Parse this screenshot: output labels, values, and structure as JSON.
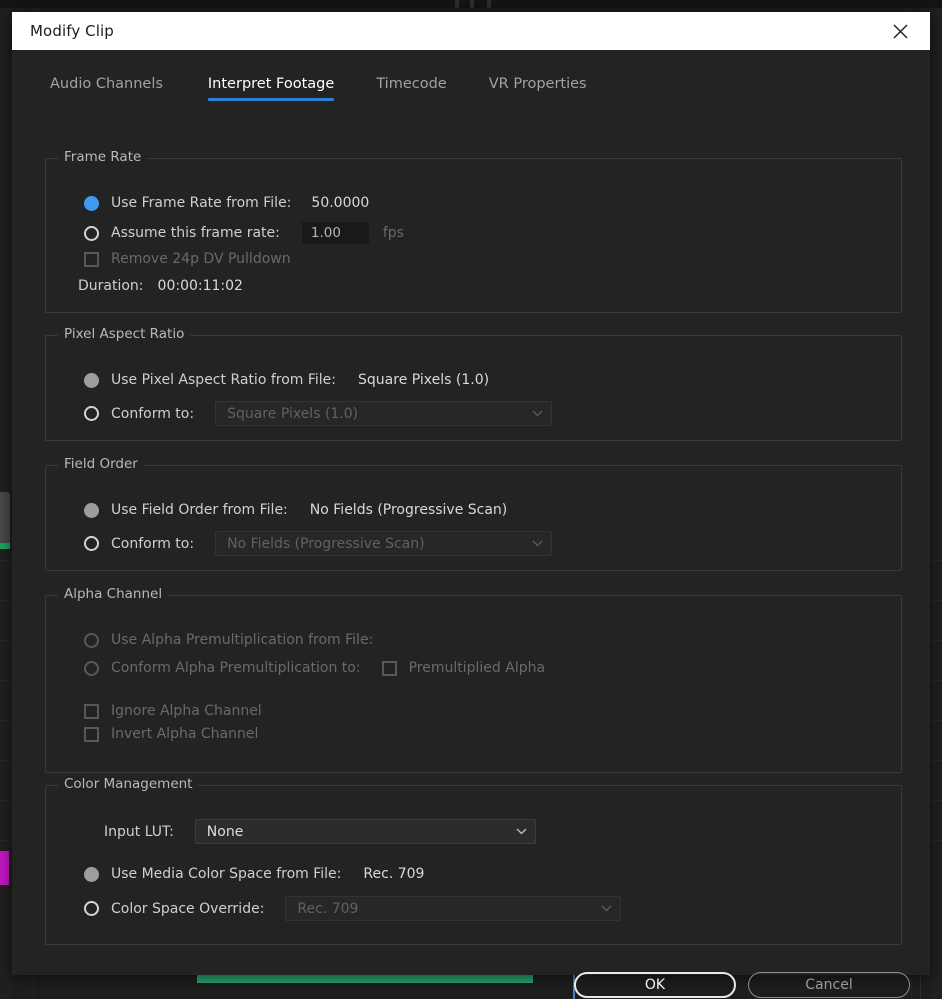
{
  "window": {
    "title": "Modify Clip",
    "close_icon": "close-icon"
  },
  "tabs": [
    {
      "label": "Audio Channels",
      "active": false
    },
    {
      "label": "Interpret Footage",
      "active": true
    },
    {
      "label": "Timecode",
      "active": false
    },
    {
      "label": "VR Properties",
      "active": false
    }
  ],
  "frame_rate": {
    "group_label": "Frame Rate",
    "use_from_file_label": "Use Frame Rate from File:",
    "use_from_file_value": "50.0000",
    "assume_label": "Assume this frame rate:",
    "assume_value": "1.00",
    "fps_label": "fps",
    "pulldown_label": "Remove 24p DV Pulldown",
    "duration_label": "Duration:",
    "duration_value": "00:00:11:02"
  },
  "pixel_aspect_ratio": {
    "group_label": "Pixel Aspect Ratio",
    "use_from_file_label": "Use Pixel Aspect Ratio from File:",
    "use_from_file_value": "Square Pixels (1.0)",
    "conform_label": "Conform to:",
    "conform_value": "Square Pixels (1.0)"
  },
  "field_order": {
    "group_label": "Field Order",
    "use_from_file_label": "Use Field Order from File:",
    "use_from_file_value": "No Fields (Progressive Scan)",
    "conform_label": "Conform to:",
    "conform_value": "No Fields (Progressive Scan)"
  },
  "alpha_channel": {
    "group_label": "Alpha Channel",
    "use_premult_label": "Use Alpha Premultiplication from File:",
    "conform_premult_label": "Conform Alpha Premultiplication to:",
    "premultiplied_label": "Premultiplied Alpha",
    "ignore_label": "Ignore Alpha Channel",
    "invert_label": "Invert Alpha Channel"
  },
  "color_management": {
    "group_label": "Color Management",
    "input_lut_label": "Input LUT:",
    "input_lut_value": "None",
    "use_media_cs_label": "Use Media Color Space from File:",
    "use_media_cs_value": "Rec. 709",
    "override_label": "Color Space Override:",
    "override_value": "Rec. 709"
  },
  "footer": {
    "ok_label": "OK",
    "cancel_label": "Cancel"
  },
  "colors": {
    "accent_blue": "#2f7fd4",
    "radio_selected_blue": "#3f9bf0",
    "dialog_bg": "#232323",
    "titlebar_bg": "#ffffff"
  }
}
